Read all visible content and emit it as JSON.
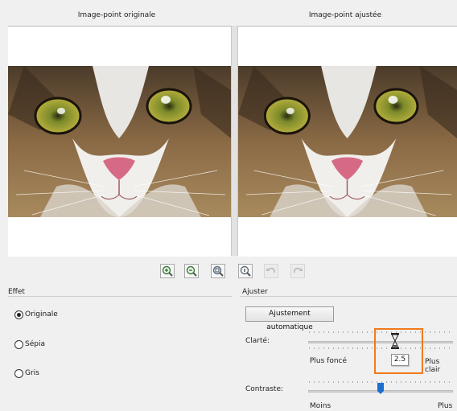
{
  "panels": {
    "original_title": "Image-point originale",
    "adjusted_title": "Image-point ajustée"
  },
  "toolbar": {
    "zoom_in": "zoom-in",
    "zoom_out": "zoom-out",
    "zoom_fit": "zoom-fit",
    "zoom_actual": "zoom-actual",
    "undo": "undo",
    "redo": "redo"
  },
  "effect": {
    "title": "Effet",
    "options": [
      {
        "label": "Originale",
        "checked": true
      },
      {
        "label": "Sépia",
        "checked": false
      },
      {
        "label": "Gris",
        "checked": false
      }
    ]
  },
  "adjust": {
    "title": "Ajuster",
    "auto_button": "Ajustement automatique",
    "brightness": {
      "label": "Clarté:",
      "min_label": "Plus foncé",
      "max_label": "Plus clair",
      "value": "2.5"
    },
    "contrast": {
      "label": "Contraste:",
      "min_label": "Moins",
      "max_label": "Plus"
    }
  },
  "colors": {
    "highlight": "#f07a1f",
    "slider_thumb_blue": "#1e6fd0"
  }
}
